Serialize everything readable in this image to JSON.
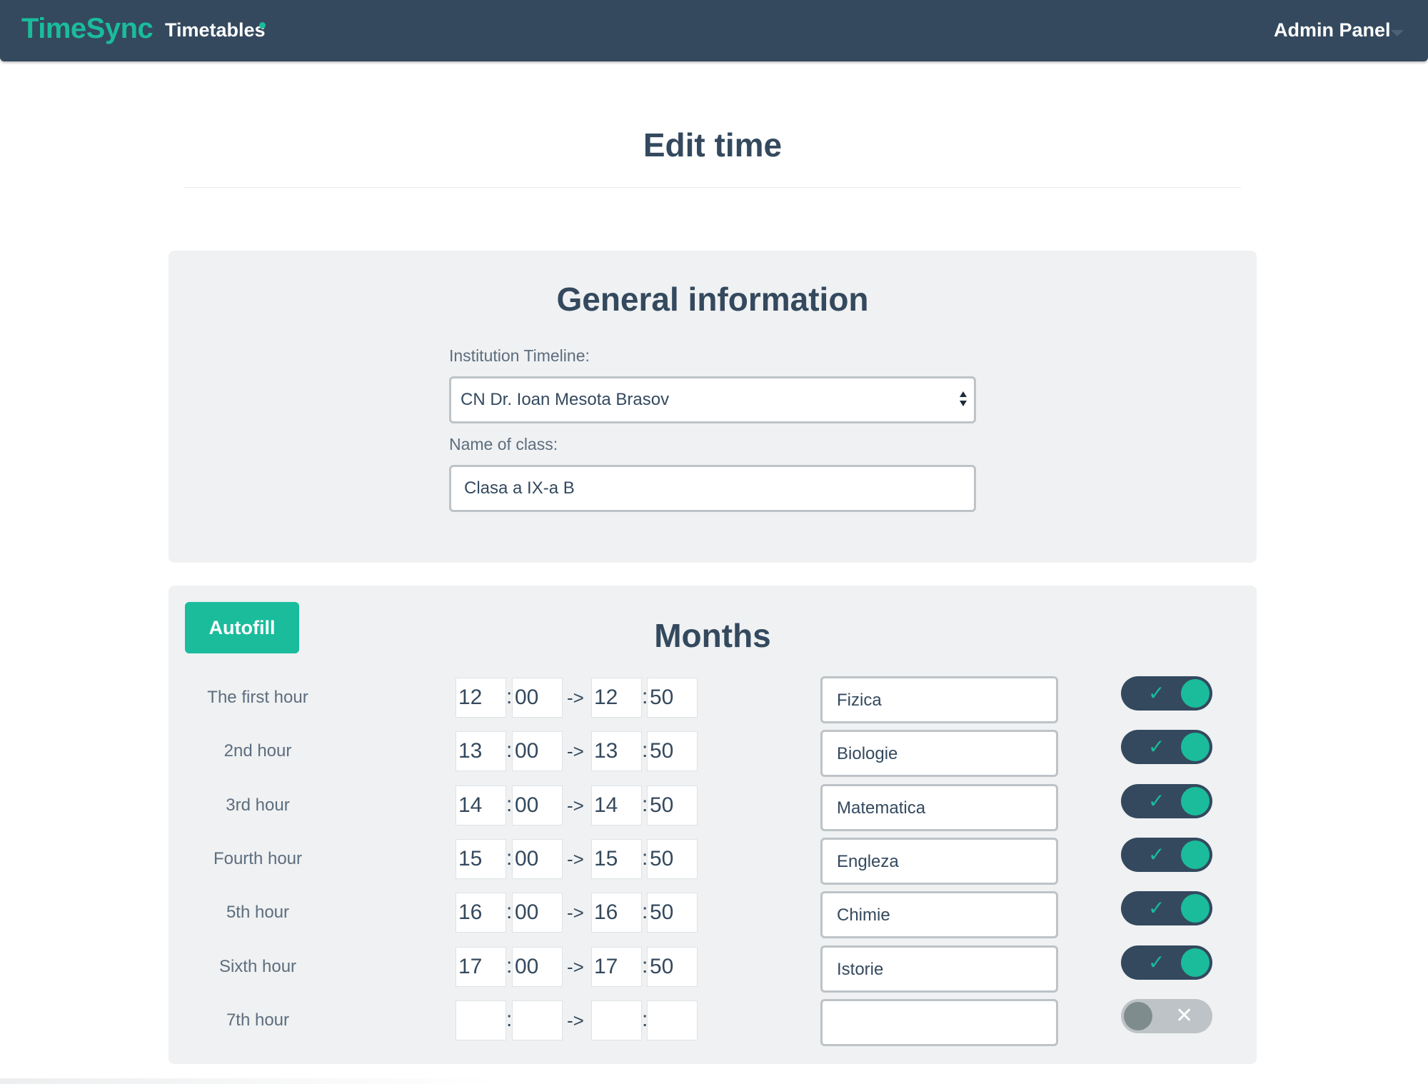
{
  "navbar": {
    "brand": "TimeSync",
    "timetables_link": "Timetables",
    "admin_menu": "Admin Panel"
  },
  "page": {
    "title": "Edit time"
  },
  "general": {
    "title": "General information",
    "institution_label": "Institution Timeline:",
    "institution_value": "CN Dr. Ioan Mesota Brasov",
    "class_label": "Name of class:",
    "class_value": "Clasa a IX-a B"
  },
  "months": {
    "title": "Months",
    "autofill_label": "Autofill",
    "arrow": "->",
    "colon": ":",
    "rows": [
      {
        "label": "The first hour",
        "start_h": "12",
        "start_m": "00",
        "end_h": "12",
        "end_m": "50",
        "subject": "Fizica",
        "enabled": true,
        "toggle_glyph": "✓"
      },
      {
        "label": "2nd hour",
        "start_h": "13",
        "start_m": "00",
        "end_h": "13",
        "end_m": "50",
        "subject": "Biologie",
        "enabled": true,
        "toggle_glyph": "✓"
      },
      {
        "label": "3rd hour",
        "start_h": "14",
        "start_m": "00",
        "end_h": "14",
        "end_m": "50",
        "subject": "Matematica",
        "enabled": true,
        "toggle_glyph": "✓"
      },
      {
        "label": "Fourth hour",
        "start_h": "15",
        "start_m": "00",
        "end_h": "15",
        "end_m": "50",
        "subject": "Engleza",
        "enabled": true,
        "toggle_glyph": "✓"
      },
      {
        "label": "5th hour",
        "start_h": "16",
        "start_m": "00",
        "end_h": "16",
        "end_m": "50",
        "subject": "Chimie",
        "enabled": true,
        "toggle_glyph": "✓"
      },
      {
        "label": "Sixth hour",
        "start_h": "17",
        "start_m": "00",
        "end_h": "17",
        "end_m": "50",
        "subject": "Istorie",
        "enabled": true,
        "toggle_glyph": "✓"
      },
      {
        "label": "7th hour",
        "start_h": "",
        "start_m": "",
        "end_h": "",
        "end_m": "",
        "subject": "",
        "enabled": false,
        "toggle_glyph": "✕"
      }
    ]
  },
  "colors": {
    "brand": "#1abc9c",
    "navbar": "#34495e",
    "panel": "#eff1f2"
  }
}
